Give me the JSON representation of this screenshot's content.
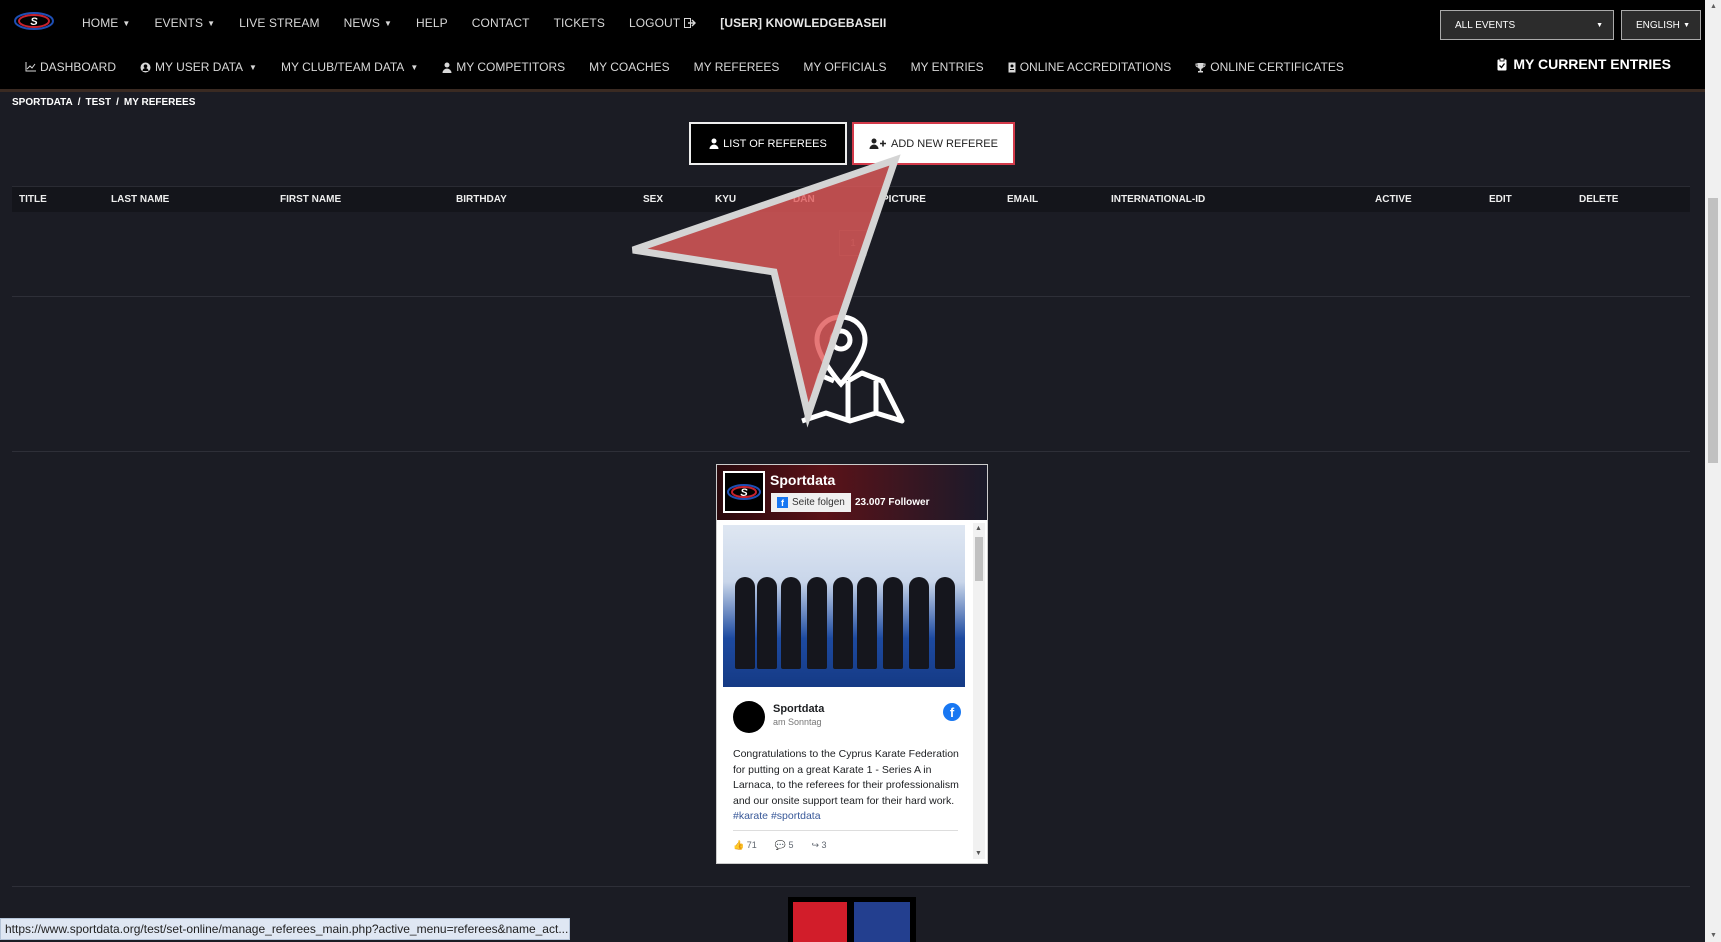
{
  "nav_primary": {
    "home": "HOME",
    "events": "EVENTS",
    "live_stream": "LIVE STREAM",
    "news": "NEWS",
    "help": "HELP",
    "contact": "CONTACT",
    "tickets": "TICKETS",
    "logout": "LOGOUT",
    "user": "[USER] KNOWLEDGEBASEII",
    "events_select": "ALL EVENTS",
    "language_select": "ENGLISH"
  },
  "nav_secondary": {
    "dashboard": "DASHBOARD",
    "my_user_data": "MY USER DATA",
    "my_club_team_data": "MY CLUB/TEAM DATA",
    "my_competitors": "MY COMPETITORS",
    "my_coaches": "MY COACHES",
    "my_referees": "MY REFEREES",
    "my_officials": "MY OFFICIALS",
    "my_entries": "MY ENTRIES",
    "online_accreditations": "ONLINE ACCREDITATIONS",
    "online_certificates": "ONLINE CERTIFICATES",
    "my_current_entries": "MY CURRENT ENTRIES"
  },
  "breadcrumb": [
    "SPORTDATA",
    "TEST",
    "MY REFEREES"
  ],
  "actions": {
    "list_label": "LIST OF REFEREES",
    "add_label": "ADD NEW REFEREE"
  },
  "table": {
    "columns": [
      "TITLE",
      "LAST NAME",
      "FIRST NAME",
      "BIRTHDAY",
      "SEX",
      "KYU",
      "DAN",
      "PICTURE",
      "EMAIL",
      "INTERNATIONAL-ID",
      "ACTIVE",
      "EDIT",
      "DELETE"
    ],
    "page": "1"
  },
  "facebook": {
    "page_name": "Sportdata",
    "follow_label": "Seite folgen",
    "followers": "23.007 Follower",
    "post_author": "Sportdata",
    "post_date": "am Sonntag",
    "post_text": "Congratulations to the Cyprus Karate Federation for putting on a great Karate 1 - Series A in Larnaca, to the referees for their professionalism and our onsite support team for their hard work.",
    "post_tags": "#karate #sportdata",
    "likes": "71",
    "comments": "5",
    "shares": "3"
  },
  "status_url": "https://www.sportdata.org/test/set-online/manage_referees_main.php?active_menu=referees&name_act...",
  "colors": {
    "accent_red": "#d33a4a",
    "flag_red": "#d21d2a",
    "flag_blue": "#233f8f",
    "background": "#1b1c24"
  }
}
